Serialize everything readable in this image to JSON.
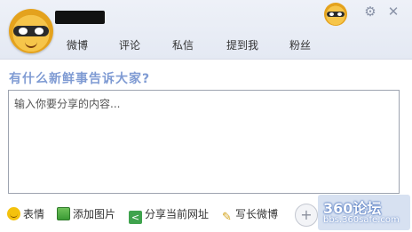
{
  "header": {
    "nav": [
      "微博",
      "评论",
      "私信",
      "提到我",
      "粉丝"
    ]
  },
  "compose": {
    "prompt": "有什么新鲜事告诉大家?",
    "placeholder": "输入你要分享的内容..."
  },
  "toolbar": {
    "tools": [
      {
        "label": "表情",
        "icon": "smile-icon"
      },
      {
        "label": "添加图片",
        "icon": "image-icon"
      },
      {
        "label": "分享当前网址",
        "icon": "share-icon"
      },
      {
        "label": "写长微博",
        "icon": "pen-icon"
      }
    ]
  },
  "watermark": {
    "brand": "360论坛",
    "site": "bbs.360safe.com"
  },
  "colors": {
    "prompt": "#7f9bd3",
    "header_bg": "#e6ebf4"
  }
}
